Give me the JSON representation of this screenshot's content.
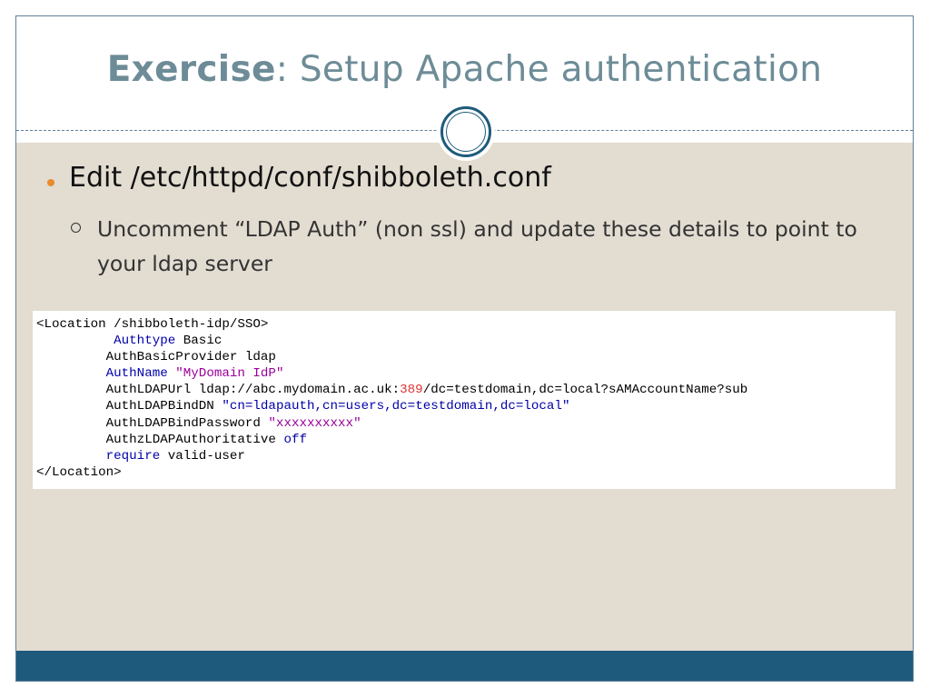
{
  "slide": {
    "title_bold": "Exercise",
    "title_rest": ": Setup Apache authentication",
    "bullet1": "Edit /etc/httpd/conf/shibboleth.conf",
    "bullet2": "Uncomment “LDAP Auth” (non ssl) and update these details to point to your ldap server"
  },
  "code": {
    "line1": "<Location /shibboleth-idp/SSO>",
    "line2_indent": "          ",
    "line2_kw": "Authtype",
    "line2_val": " Basic",
    "line3_indent": "         ",
    "line3_text": "AuthBasicProvider ldap",
    "line4_indent": "         ",
    "line4_kw": "AuthName",
    "line4_sp": " ",
    "line4_str": "\"MyDomain IdP\"",
    "line5_indent": "         ",
    "line5_text": "AuthLDAPUrl ldap://abc.mydomain.ac.uk:",
    "line5_port": "389",
    "line5_rest": "/dc=testdomain,dc=local?sAMAccountName?sub",
    "line6_indent": "         ",
    "line6_text": "AuthLDAPBindDN ",
    "line6_str": "\"cn=ldapauth,cn=users,dc=testdomain,dc=local\"",
    "line7_indent": "         ",
    "line7_text": "AuthLDAPBindPassword ",
    "line7_str": "\"xxxxxxxxxx\"",
    "line8_indent": "         ",
    "line8_text": "AuthzLDAPAuthoritative ",
    "line8_kw": "off",
    "line9_indent": "         ",
    "line9_kw": "require",
    "line9_text": " valid-user",
    "line10": "</Location>"
  },
  "colors": {
    "title": "#6d8c97",
    "accent_bar": "#1e5a7b",
    "body_bg": "#e2dcd1",
    "bullet": "#e88c2c"
  }
}
